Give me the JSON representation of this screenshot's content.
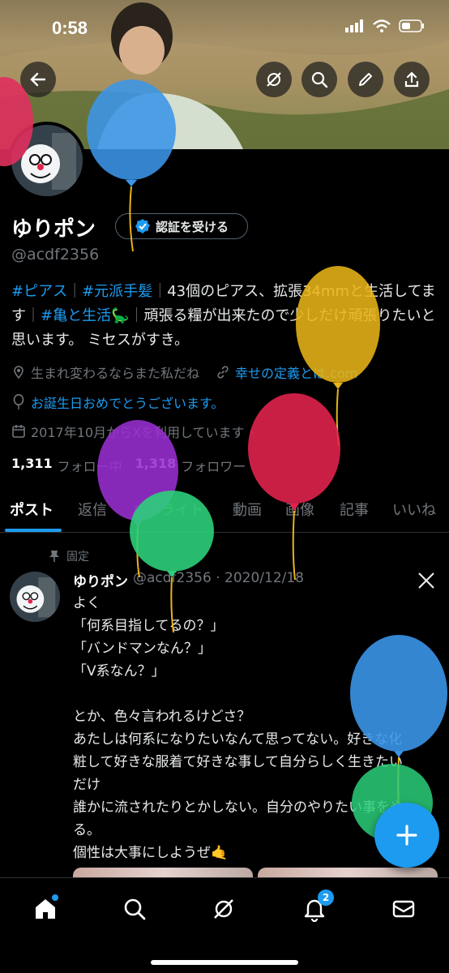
{
  "status_bar": {
    "time": "0:58"
  },
  "profile": {
    "name": "ゆりポン",
    "verify_label": "認証を受ける",
    "handle": "@acdf2356",
    "bio": {
      "tag1": "#ピアス",
      "sep1": "｜",
      "tag2": "#元派手髪",
      "sep2": "｜",
      "text1": "43個のピアス、拡張34mmと生活してます",
      "sep3": "｜",
      "tag3": "#亀と生活",
      "emoji": "🦕",
      "sep4": "｜",
      "text2": "頑張る糧が出来たので少しだけ頑張りたいと思います。 ミセスがすき。"
    },
    "location": "生まれ変わるならまた私だね",
    "link": "幸せの定義とは.com",
    "birthday": "お誕生日おめでとうございます。",
    "joined": "2017年10月からXを利用しています",
    "following_count": "1,311",
    "following_label": "フォロー中",
    "followers_count": "1,318",
    "followers_label": "フォロワー"
  },
  "tabs": [
    {
      "label": "ポスト"
    },
    {
      "label": "返信"
    },
    {
      "label": "ハイライト"
    },
    {
      "label": "動画"
    },
    {
      "label": "画像"
    },
    {
      "label": "記事"
    },
    {
      "label": "いいね"
    }
  ],
  "pinned_post": {
    "pinned_label": "固定",
    "author": "ゆりポン",
    "handle_date": "@acdf2356 · 2020/12/18",
    "body": "よく\n「何系目指してるの？」\n「バンドマンなん？」\n「V系なん？」\n\nとか、色々言われるけどさ？\nあたしは何系になりたいなんて思ってない。好きな化粧して好きな服着て好きな事して自分らしく生きたいだけ\n誰かに流されたりとかしない。自分のやりたい事をやる。\n個性は大事にしようぜ🤙"
  },
  "bottom_nav": {
    "notifications_badge": "2"
  },
  "colors": {
    "accent": "#1d9bf0",
    "muted": "#71767b",
    "background": "#000000",
    "balloon_blue": "#3b95e8",
    "balloon_yellow": "#e8b418",
    "balloon_red": "#e0224d",
    "balloon_purple": "#9a2fd1",
    "balloon_green": "#2ccf7a"
  },
  "icons": [
    "back-arrow-icon",
    "grok-icon",
    "search-icon",
    "edit-icon",
    "share-icon",
    "verified-badge-icon",
    "location-icon",
    "link-icon",
    "balloon-icon",
    "calendar-icon",
    "pin-icon",
    "x-logo-icon",
    "plus-icon",
    "home-icon",
    "bell-icon",
    "mail-icon"
  ]
}
